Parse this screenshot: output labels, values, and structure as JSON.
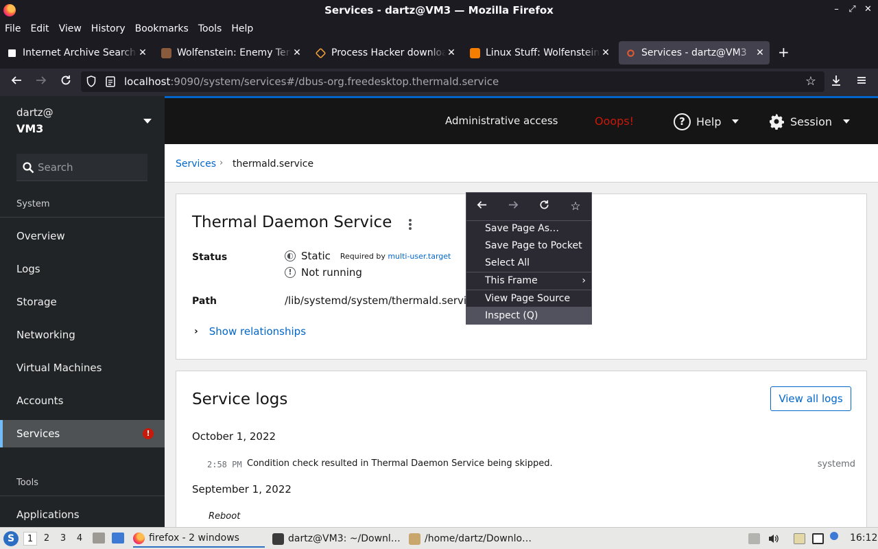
{
  "window": {
    "title": "Services - dartz@VM3 — Mozilla Firefox",
    "controls": [
      "–",
      "⤢",
      "✕"
    ]
  },
  "menubar": [
    "File",
    "Edit",
    "View",
    "History",
    "Bookmarks",
    "Tools",
    "Help"
  ],
  "tabs": [
    {
      "label": "Internet Archive Search:",
      "icon": "internet-archive-icon",
      "active": false
    },
    {
      "label": "Wolfenstein: Enemy Territory",
      "icon": "wolfenstein-icon",
      "active": false
    },
    {
      "label": "Process Hacker download",
      "icon": "process-hacker-icon",
      "active": false
    },
    {
      "label": "Linux Stuff: Wolfenstein:",
      "icon": "blogger-icon",
      "active": false
    },
    {
      "label": "Services - dartz@VM3",
      "icon": "cockpit-icon",
      "active": true
    }
  ],
  "url": {
    "host": "localhost",
    "rest": ":9090/system/services#/dbus-org.freedesktop.thermald.service"
  },
  "sidebar": {
    "user": "dartz@",
    "host": "VM3",
    "search_placeholder": "Search",
    "system_label": "System",
    "items": [
      {
        "label": "Overview"
      },
      {
        "label": "Logs"
      },
      {
        "label": "Storage"
      },
      {
        "label": "Networking"
      },
      {
        "label": "Virtual Machines"
      },
      {
        "label": "Accounts"
      },
      {
        "label": "Services",
        "active": true,
        "alert": "!"
      }
    ],
    "tools_label": "Tools",
    "tools_items": [
      {
        "label": "Applications"
      }
    ]
  },
  "masthead": {
    "admin": "Administrative access",
    "error": "Ooops!",
    "help": "Help",
    "session": "Session",
    "colors": {
      "error": "#c9190b",
      "accent": "#0066cc"
    }
  },
  "breadcrumb": {
    "parent": "Services",
    "current": "thermald.service"
  },
  "service": {
    "title": "Thermal Daemon Service",
    "status_label": "Status",
    "status_state": "Static",
    "required_by_prefix": "Required by",
    "required_by_target": "multi-user.target",
    "running_state": "Not running",
    "path_label": "Path",
    "path_value": "/lib/systemd/system/thermald.service",
    "relationships": "Show relationships"
  },
  "logs": {
    "title": "Service logs",
    "view_all": "View all logs",
    "groups": [
      {
        "date": "October 1, 2022",
        "entries": [
          {
            "time": "2:58 PM",
            "message": "Condition check resulted in Thermal Daemon Service being skipped.",
            "source": "systemd"
          }
        ]
      },
      {
        "date": "September 1, 2022",
        "entries": [
          {
            "reboot": "Reboot"
          }
        ]
      }
    ]
  },
  "context_menu": {
    "items": [
      {
        "label": "Save Page As…"
      },
      {
        "label": "Save Page to Pocket"
      },
      {
        "label": "Select All"
      },
      {
        "label": "This Frame",
        "submenu": "›"
      },
      {
        "label": "View Page Source"
      },
      {
        "label": "Inspect (Q)",
        "hover": true
      }
    ]
  },
  "taskbar": {
    "workspaces": [
      "1",
      "2",
      "3",
      "4"
    ],
    "tasks": [
      {
        "label": "firefox - 2 windows",
        "active": true
      },
      {
        "label": "dartz@VM3: ~/Downl…"
      },
      {
        "label": "/home/dartz/Downlo…"
      }
    ],
    "clock": "16:12"
  }
}
